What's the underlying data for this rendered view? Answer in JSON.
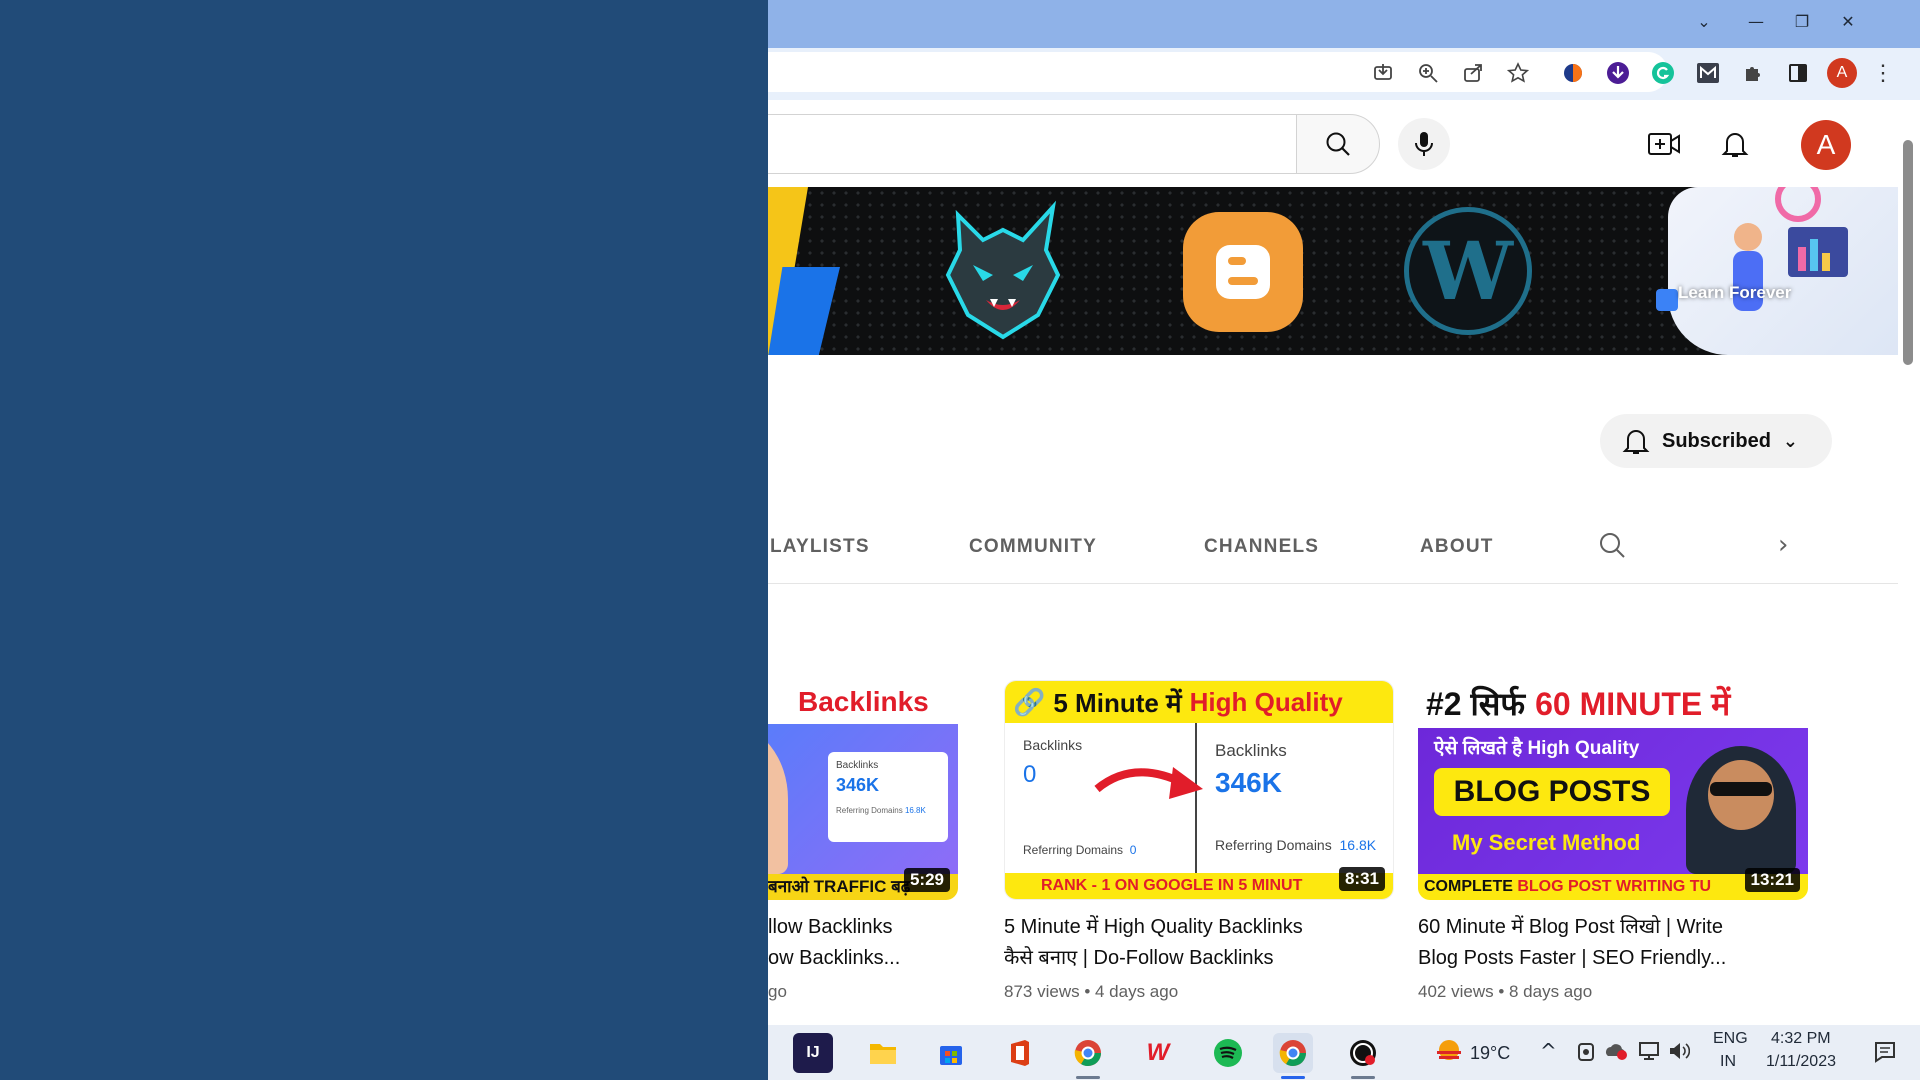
{
  "browser": {
    "profile_initial": "A",
    "toolbar_icons": [
      "install-icon",
      "zoom-icon",
      "share-icon",
      "star-icon",
      "extension-icon",
      "download-extension-icon",
      "grammarly-icon",
      "gmail-icon",
      "puzzle-icon",
      "sidepanel-icon"
    ]
  },
  "header": {
    "avatar_initial": "A"
  },
  "banner": {
    "learn_label": "Learn Forever"
  },
  "channel": {
    "subscribed_label": "Subscribed"
  },
  "tabs": [
    {
      "label": "LAYLISTS"
    },
    {
      "label": "COMMUNITY"
    },
    {
      "label": "CHANNELS"
    },
    {
      "label": "ABOUT"
    }
  ],
  "videos": [
    {
      "thumb_headline": "Backlinks",
      "thumb_stat_label": "Backlinks",
      "thumb_stat_value": "346K",
      "thumb_sub": "Referring Domains",
      "thumb_sub_value": "16.8K",
      "thumb_footer": "बनाओ TRAFFIC बढ़",
      "duration": "5:29",
      "title_line1": "llow Backlinks",
      "title_line2": "ow Backlinks...",
      "meta": "go"
    },
    {
      "thumb_headline_a": "5 Minute में",
      "thumb_headline_b": "High Quality",
      "left_label": "Backlinks",
      "left_value": "0",
      "left_sub": "Referring Domains",
      "left_sub_value": "0",
      "right_label": "Backlinks",
      "right_value": "346K",
      "right_sub": "Referring Domains",
      "right_sub_value": "16.8K",
      "thumb_footer": "RANK - 1 ON GOOGLE IN 5 MINUT",
      "duration": "8:31",
      "title_line1": "5 Minute में High Quality Backlinks",
      "title_line2": "कैसे बनाए | Do-Follow Backlinks",
      "meta": "873 views • 4 days ago"
    },
    {
      "thumb_headline_a": "#2 सिर्फ",
      "thumb_headline_b": "60 MINUTE में",
      "thumb_line1": "ऐसे लिखते है High Quality",
      "thumb_line2": "BLOG POSTS",
      "thumb_line3": "My Secret Method",
      "thumb_footer_a": "COMPLETE",
      "thumb_footer_b": "BLOG POST WRITING TU",
      "duration": "13:21",
      "title_line1": "60 Minute में Blog Post लिखो | Write",
      "title_line2": "Blog Posts Faster | SEO Friendly...",
      "meta": "402 views • 8 days ago"
    }
  ],
  "taskbar": {
    "weather": "19°C",
    "lang_top": "ENG",
    "lang_bottom": "IN",
    "time": "4:32 PM",
    "date": "1/11/2023"
  }
}
